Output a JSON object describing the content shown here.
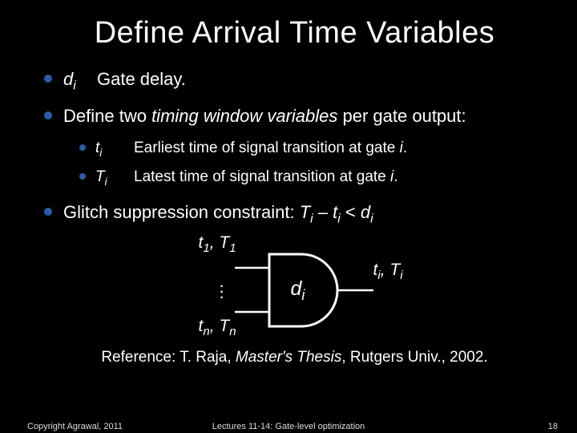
{
  "title": "Define Arrival Time Variables",
  "b1": {
    "sym": "d",
    "sub": "i",
    "text": "Gate delay."
  },
  "b2": {
    "pre": "Define two ",
    "em": "timing window variables",
    "post": " per gate output:"
  },
  "b2a": {
    "sym": "t",
    "sub": "i",
    "text": "Earliest time of signal transition at gate ",
    "tail": "i",
    "dot": "."
  },
  "b2b": {
    "sym": "T",
    "sub": "i",
    "text": "Latest time of signal transition at gate ",
    "tail": "i",
    "dot": "."
  },
  "b3": {
    "pre": "Glitch suppression constraint:   ",
    "expr": {
      "a": "T",
      "as": "i",
      "m1": " – ",
      "b": "t",
      "bs": "i",
      "m2": " < ",
      "c": "d",
      "cs": "i"
    }
  },
  "diagram": {
    "in_first": {
      "a": "t",
      "as": "1",
      "b": "T",
      "bs": "1"
    },
    "in_last": {
      "a": "t",
      "as": "n",
      "b": "T",
      "bs": "n"
    },
    "out": {
      "a": "t",
      "as": "i",
      "b": "T",
      "bs": "i"
    },
    "body": {
      "a": "d",
      "as": "i"
    }
  },
  "reference": {
    "pre": "Reference: T. Raja, ",
    "em": "Master's Thesis",
    "post": ", Rutgers Univ., 2002."
  },
  "footer": {
    "left": "Copyright Agrawal, 2011",
    "center": "Lectures 11-14: Gate-level optimization",
    "right": "18"
  }
}
